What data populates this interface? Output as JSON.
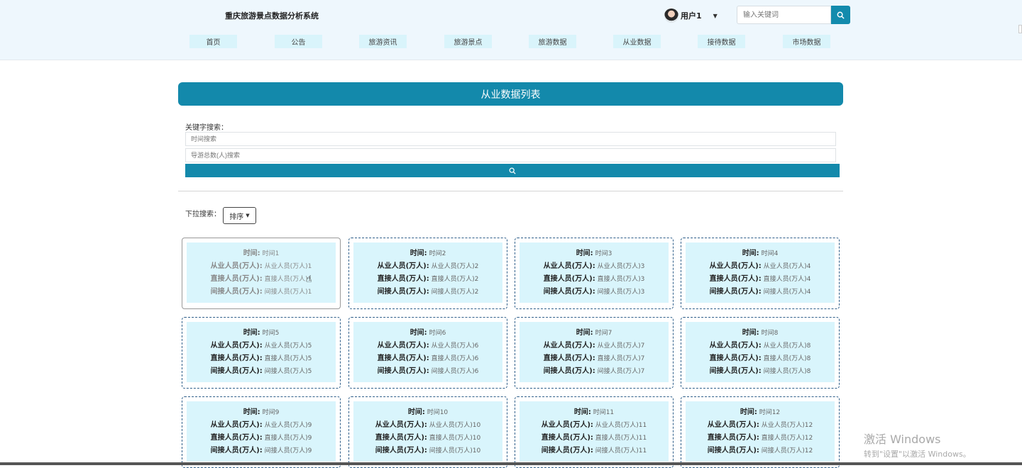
{
  "header": {
    "site_title": "重庆旅游景点数据分析系统",
    "user_name": "用户1",
    "search_placeholder": "输入关键词"
  },
  "nav": {
    "items": [
      {
        "label": "首页"
      },
      {
        "label": "公告"
      },
      {
        "label": "旅游资讯"
      },
      {
        "label": "旅游景点"
      },
      {
        "label": "旅游数据"
      },
      {
        "label": "从业数据"
      },
      {
        "label": "接待数据"
      },
      {
        "label": "市场数据"
      }
    ]
  },
  "page": {
    "banner_title": "从业数据列表",
    "keyword_label": "关键字搜索：",
    "time_placeholder": "时间搜索",
    "guide_placeholder": "导游总数(人)搜索",
    "dropdown_label": "下拉搜索：",
    "sort_label": "排序"
  },
  "cards": [
    {
      "time_label": "时间:",
      "time_value": "时间1",
      "r1_label": "从业人员(万人):",
      "r1_value": "从业人员(万人)1",
      "r2_label": "直接人员(万人):",
      "r2_value": "直接人员(万人)1",
      "r3_label": "间接人员(万人):",
      "r3_value": "间接人员(万人)1"
    },
    {
      "time_label": "时间:",
      "time_value": "时间2",
      "r1_label": "从业人员(万人):",
      "r1_value": "从业人员(万人)2",
      "r2_label": "直接人员(万人):",
      "r2_value": "直接人员(万人)2",
      "r3_label": "间接人员(万人):",
      "r3_value": "间接人员(万人)2"
    },
    {
      "time_label": "时间:",
      "time_value": "时间3",
      "r1_label": "从业人员(万人):",
      "r1_value": "从业人员(万人)3",
      "r2_label": "直接人员(万人):",
      "r2_value": "直接人员(万人)3",
      "r3_label": "间接人员(万人):",
      "r3_value": "间接人员(万人)3"
    },
    {
      "time_label": "时间:",
      "time_value": "时间4",
      "r1_label": "从业人员(万人):",
      "r1_value": "从业人员(万人)4",
      "r2_label": "直接人员(万人):",
      "r2_value": "直接人员(万人)4",
      "r3_label": "间接人员(万人):",
      "r3_value": "间接人员(万人)4"
    },
    {
      "time_label": "时间:",
      "time_value": "时间5",
      "r1_label": "从业人员(万人):",
      "r1_value": "从业人员(万人)5",
      "r2_label": "直接人员(万人):",
      "r2_value": "直接人员(万人)5",
      "r3_label": "间接人员(万人):",
      "r3_value": "间接人员(万人)5"
    },
    {
      "time_label": "时间:",
      "time_value": "时间6",
      "r1_label": "从业人员(万人):",
      "r1_value": "从业人员(万人)6",
      "r2_label": "直接人员(万人):",
      "r2_value": "直接人员(万人)6",
      "r3_label": "间接人员(万人):",
      "r3_value": "间接人员(万人)6"
    },
    {
      "time_label": "时间:",
      "time_value": "时间7",
      "r1_label": "从业人员(万人):",
      "r1_value": "从业人员(万人)7",
      "r2_label": "直接人员(万人):",
      "r2_value": "直接人员(万人)7",
      "r3_label": "间接人员(万人):",
      "r3_value": "间接人员(万人)7"
    },
    {
      "time_label": "时间:",
      "time_value": "时间8",
      "r1_label": "从业人员(万人):",
      "r1_value": "从业人员(万人)8",
      "r2_label": "直接人员(万人):",
      "r2_value": "直接人员(万人)8",
      "r3_label": "间接人员(万人):",
      "r3_value": "间接人员(万人)8"
    },
    {
      "time_label": "时间:",
      "time_value": "时间9",
      "r1_label": "从业人员(万人):",
      "r1_value": "从业人员(万人)9",
      "r2_label": "直接人员(万人):",
      "r2_value": "直接人员(万人)9",
      "r3_label": "间接人员(万人):",
      "r3_value": "间接人员(万人)9"
    },
    {
      "time_label": "时间:",
      "time_value": "时间10",
      "r1_label": "从业人员(万人):",
      "r1_value": "从业人员(万人)10",
      "r2_label": "直接人员(万人):",
      "r2_value": "直接人员(万人)10",
      "r3_label": "间接人员(万人):",
      "r3_value": "间接人员(万人)10"
    },
    {
      "time_label": "时间:",
      "time_value": "时间11",
      "r1_label": "从业人员(万人):",
      "r1_value": "从业人员(万人)11",
      "r2_label": "直接人员(万人):",
      "r2_value": "直接人员(万人)11",
      "r3_label": "间接人员(万人):",
      "r3_value": "间接人员(万人)11"
    },
    {
      "time_label": "时间:",
      "time_value": "时间12",
      "r1_label": "从业人员(万人):",
      "r1_value": "从业人员(万人)12",
      "r2_label": "直接人员(万人):",
      "r2_value": "直接人员(万人)12",
      "r3_label": "间接人员(万人):",
      "r3_value": "间接人员(万人)12"
    }
  ],
  "watermark": {
    "line1": "激活 Windows",
    "line2": "转到\"设置\"以激活 Windows。"
  },
  "colors": {
    "accent": "#1389ab",
    "header_bg": "#eef7fd",
    "nav_item_bg": "#d9f4fb",
    "card_bg": "#d9f5fc"
  }
}
